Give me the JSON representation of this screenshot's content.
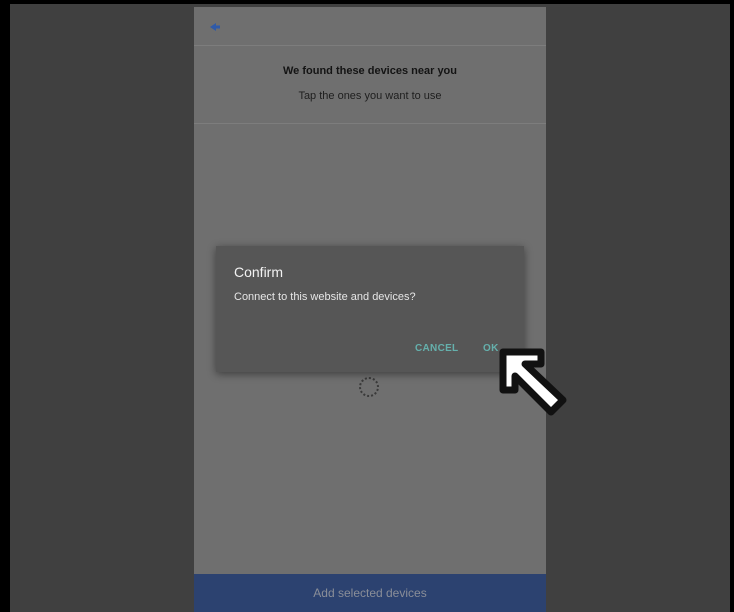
{
  "page": {
    "heading": "We found these devices near you",
    "subheading": "Tap the ones you want to use",
    "add_button_label": "Add selected devices"
  },
  "dialog": {
    "title": "Confirm",
    "message": "Connect to this website and devices?",
    "cancel_label": "CANCEL",
    "ok_label": "OK"
  },
  "icons": {
    "back": "arrow-left-icon",
    "spinner": "loading-spinner-icon",
    "cursor": "mouse-pointer-icon"
  },
  "colors": {
    "accent_blue": "#2c4270",
    "dialog_button": "#65b0ac",
    "back_arrow": "#2f5aa8"
  }
}
